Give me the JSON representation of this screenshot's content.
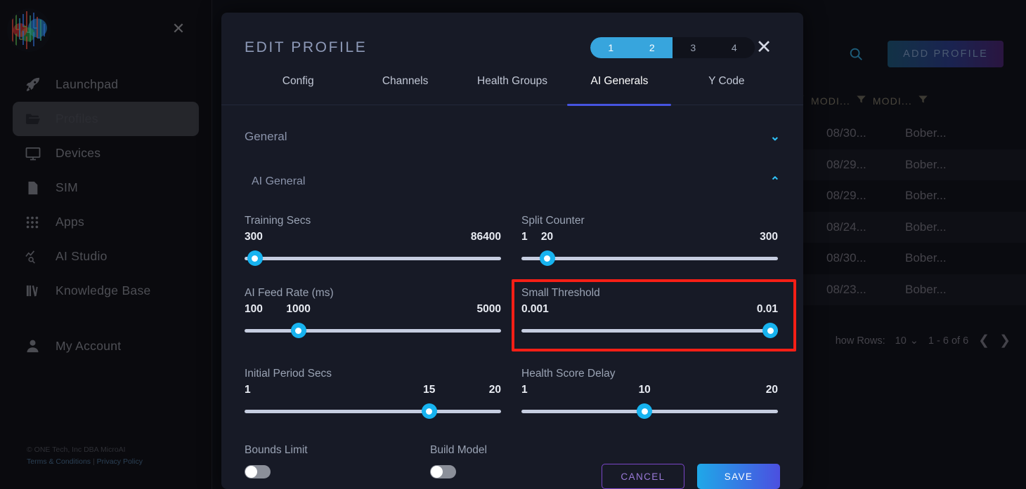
{
  "sidebar": {
    "logo_name": "microai-circuit-logo",
    "close_label": "✕",
    "items": [
      {
        "label": "Launchpad",
        "icon": "rocket-icon",
        "active": false
      },
      {
        "label": "Profiles",
        "icon": "folder-open-icon",
        "active": true
      },
      {
        "label": "Devices",
        "icon": "monitor-icon",
        "active": false
      },
      {
        "label": "SIM",
        "icon": "sim-card-icon",
        "active": false
      },
      {
        "label": "Apps",
        "icon": "grid-apps-icon",
        "active": false
      },
      {
        "label": "AI Studio",
        "icon": "analytics-search-icon",
        "active": false
      },
      {
        "label": "Knowledge Base",
        "icon": "books-icon",
        "active": false
      },
      {
        "label": "My Account",
        "icon": "user-icon",
        "active": false
      }
    ],
    "footer": {
      "copyright": "© ONE Tech, Inc DBA MicroAI",
      "terms": "Terms & Conditions",
      "separator": "|",
      "privacy": "Privacy Policy"
    }
  },
  "background": {
    "search_icon": "search-icon",
    "add_profile_label": "ADD PROFILE",
    "columns": [
      {
        "label": "MODI...",
        "filter_icon": "filter-icon"
      },
      {
        "label": "MODI...",
        "filter_icon": "filter-icon"
      }
    ],
    "rows": [
      {
        "trunc": "..",
        "date": "08/30...",
        "user": "Bober..."
      },
      {
        "trunc": "..",
        "date": "08/29...",
        "user": "Bober..."
      },
      {
        "trunc": "..",
        "date": "08/29...",
        "user": "Bober..."
      },
      {
        "trunc": "..",
        "date": "08/24...",
        "user": "Bober..."
      },
      {
        "trunc": "..",
        "date": "08/30...",
        "user": "Bober..."
      },
      {
        "trunc": "..",
        "date": "08/23...",
        "user": "Bober..."
      }
    ],
    "pager": {
      "show_rows_label": "how Rows:",
      "rows_value": "10",
      "chevron": "⌄",
      "range": "1 - 6 of 6",
      "prev": "❮",
      "next": "❯"
    }
  },
  "modal": {
    "title": "EDIT PROFILE",
    "close_label": "✕",
    "steps": [
      {
        "label": "1",
        "on": true
      },
      {
        "label": "2",
        "on": true
      },
      {
        "label": "3",
        "on": false
      },
      {
        "label": "4",
        "on": false
      }
    ],
    "tabs": [
      {
        "label": "Config",
        "active": false
      },
      {
        "label": "Channels",
        "active": false
      },
      {
        "label": "Health Groups",
        "active": false
      },
      {
        "label": "AI Generals",
        "active": true
      },
      {
        "label": "Y Code",
        "active": false
      }
    ],
    "sections": [
      {
        "title": "General",
        "expanded": false,
        "chevron": "⌄"
      },
      {
        "title": "AI General",
        "expanded": true,
        "chevron": "⌃"
      }
    ],
    "sliders": [
      {
        "label": "Training Secs",
        "min": "300",
        "max": "86400",
        "current": null,
        "thumb_pct": 4
      },
      {
        "label": "Split Counter",
        "min": "1",
        "max": "300",
        "current": "20",
        "thumb_pct": 10
      },
      {
        "label": "AI Feed Rate (ms)",
        "min": "100",
        "max": "5000",
        "current": "1000",
        "thumb_pct": 21
      },
      {
        "label": "Small Threshold",
        "min": "0.001",
        "max": "0.01",
        "current": null,
        "thumb_pct": 97,
        "highlighted": true
      },
      {
        "label": "Initial Period Secs",
        "min": "1",
        "max": "20",
        "current": "15",
        "thumb_pct": 72
      },
      {
        "label": "Health Score Delay",
        "min": "1",
        "max": "20",
        "current": "10",
        "thumb_pct": 48
      }
    ],
    "toggles": [
      {
        "label": "Bounds Limit",
        "on": false
      },
      {
        "label": "Build Model",
        "on": false
      }
    ],
    "footer": {
      "cancel_label": "CANCEL",
      "save_label": "SAVE"
    }
  },
  "colors": {
    "accent_cyan": "#17b3ef",
    "step_active": "#37a5dd",
    "tab_underline": "#4654e0",
    "highlight_box": "#f61f16",
    "modal_bg": "#171a26",
    "slider_track": "#c6cde0"
  }
}
